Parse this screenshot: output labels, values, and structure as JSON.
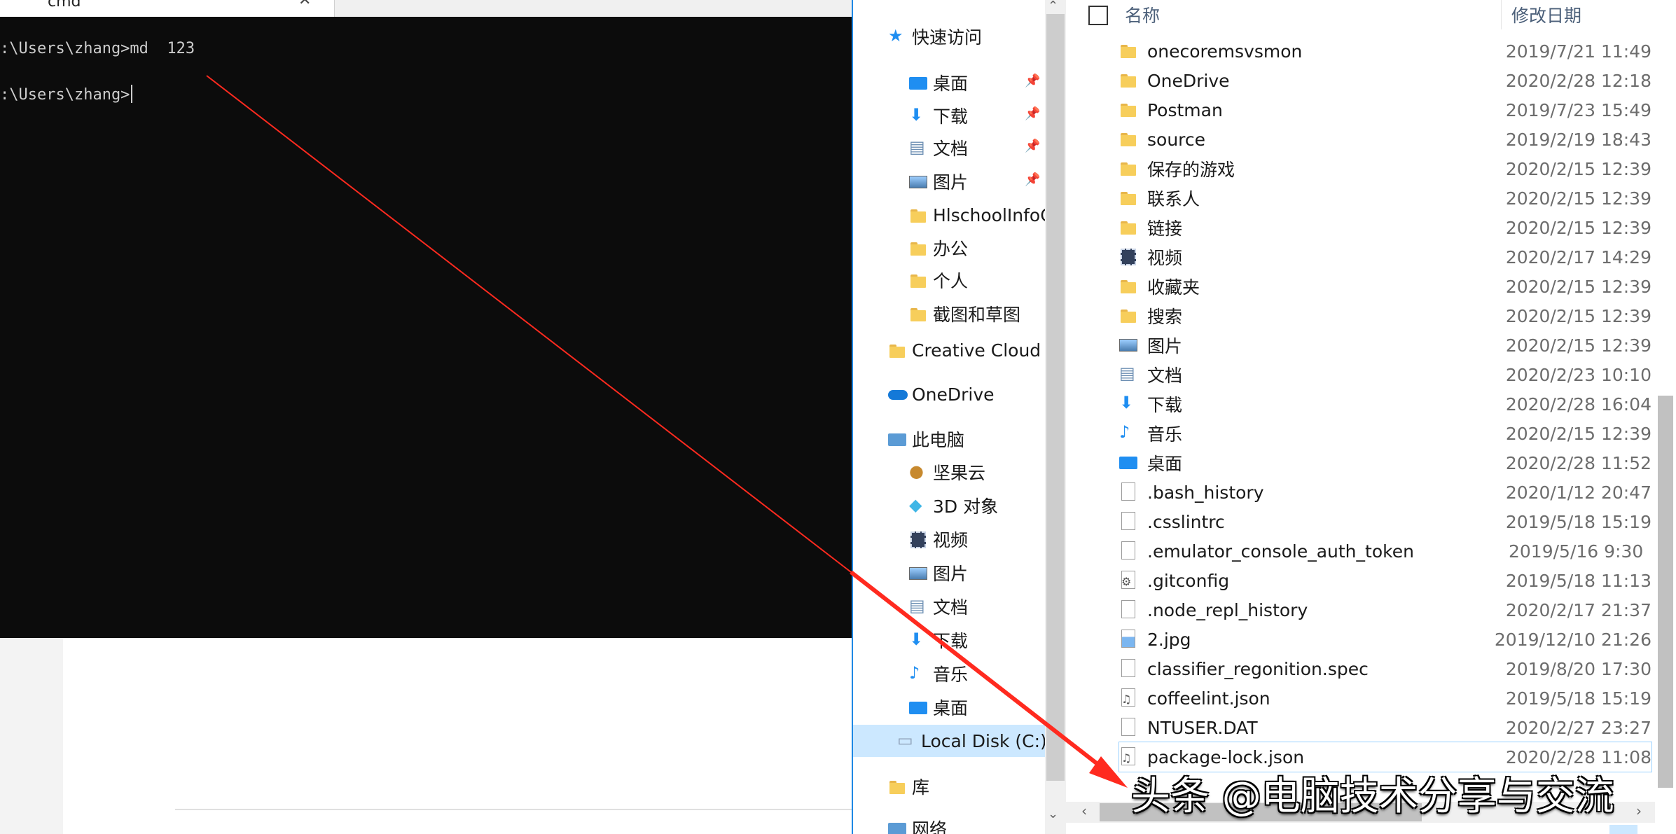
{
  "cmd": {
    "title": "cmd",
    "close_glyph": "✕",
    "line1": ":\\Users\\zhang>md  123",
    "line2": ":\\Users\\zhang>"
  },
  "nav": {
    "scroll_up": "⌃",
    "scroll_down": "⌄",
    "pin_glyph": "📌",
    "quick_access": "快速访问",
    "items": [
      {
        "label": "桌面",
        "icon": "desktop-icon"
      },
      {
        "label": "下载",
        "icon": "download-icon"
      },
      {
        "label": "文档",
        "icon": "document-icon"
      },
      {
        "label": "图片",
        "icon": "picture-icon"
      },
      {
        "label": "HlschoolInfoCo",
        "icon": "folder-icon"
      },
      {
        "label": "办公",
        "icon": "folder-icon"
      },
      {
        "label": "个人",
        "icon": "folder-icon"
      },
      {
        "label": "截图和草图",
        "icon": "folder-icon"
      }
    ],
    "creative_cloud": "Creative Cloud F",
    "onedrive": "OneDrive",
    "this_pc": "此电脑",
    "pc_items": [
      {
        "label": "坚果云",
        "icon": "nutstore-icon"
      },
      {
        "label": "3D 对象",
        "icon": "3d-objects-icon"
      },
      {
        "label": "视频",
        "icon": "video-icon"
      },
      {
        "label": "图片",
        "icon": "picture-icon"
      },
      {
        "label": "文档",
        "icon": "document-icon"
      },
      {
        "label": "下载",
        "icon": "download-icon"
      },
      {
        "label": "音乐",
        "icon": "music-icon"
      },
      {
        "label": "桌面",
        "icon": "desktop-icon"
      },
      {
        "label": "Local Disk (C:)",
        "icon": "drive-icon"
      }
    ],
    "library": "库",
    "network": "网络"
  },
  "list": {
    "header_name": "名称",
    "header_date": "修改日期",
    "scroll_left": "‹",
    "scroll_right": "›",
    "rows": [
      {
        "name": "onecoremsvsmon",
        "date": "2019/7/21 11:49"
      },
      {
        "name": "OneDrive",
        "date": "2020/2/28 12:18"
      },
      {
        "name": "Postman",
        "date": "2019/7/23 15:49"
      },
      {
        "name": "source",
        "date": "2019/2/19 18:43"
      },
      {
        "name": "保存的游戏",
        "date": "2020/2/15 12:39"
      },
      {
        "name": "联系人",
        "date": "2020/2/15 12:39"
      },
      {
        "name": "链接",
        "date": "2020/2/15 12:39"
      },
      {
        "name": "视频",
        "date": "2020/2/17 14:29"
      },
      {
        "name": "收藏夹",
        "date": "2020/2/15 12:39"
      },
      {
        "name": "搜索",
        "date": "2020/2/15 12:39"
      },
      {
        "name": "图片",
        "date": "2020/2/15 12:39"
      },
      {
        "name": "文档",
        "date": "2020/2/23 10:10"
      },
      {
        "name": "下载",
        "date": "2020/2/28 16:04"
      },
      {
        "name": "音乐",
        "date": "2020/2/15 12:39"
      },
      {
        "name": "桌面",
        "date": "2020/2/28 11:52"
      },
      {
        "name": ".bash_history",
        "date": "2020/1/12 20:47"
      },
      {
        "name": ".csslintrc",
        "date": "2019/5/18 15:19"
      },
      {
        "name": ".emulator_console_auth_token",
        "date": "2019/5/16 9:30"
      },
      {
        "name": ".gitconfig",
        "date": "2019/5/18 11:13"
      },
      {
        "name": ".node_repl_history",
        "date": "2020/2/17 21:37"
      },
      {
        "name": "2.jpg",
        "date": "2019/12/10 21:26"
      },
      {
        "name": "classifier_regonition.spec",
        "date": "2019/8/20 17:30"
      },
      {
        "name": "coffeelint.json",
        "date": "2019/5/18 15:19"
      },
      {
        "name": "NTUSER.DAT",
        "date": "2020/2/27 23:27"
      },
      {
        "name": "package-lock.json",
        "date": "2020/2/28 11:08"
      }
    ]
  },
  "annotation": {
    "color": "#ff2a1f"
  },
  "watermark": "头条 @电脑技术分享与交流"
}
